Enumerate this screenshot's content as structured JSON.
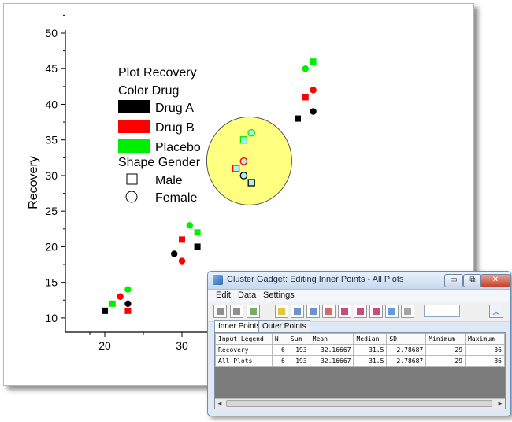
{
  "chart_data": {
    "type": "scatter",
    "ylabel": "Recovery",
    "xlabel": "",
    "xlim": [
      15,
      50
    ],
    "ylim": [
      8,
      50
    ],
    "x_ticks": [
      20,
      30
    ],
    "y_ticks": [
      10,
      15,
      20,
      25,
      30,
      35,
      40,
      45,
      50
    ],
    "colors": {
      "Drug A": "#000000",
      "Drug B": "#ff0000",
      "Placebo": "#00ee00"
    },
    "points": [
      {
        "x": 20,
        "y": 11,
        "color": "Drug A",
        "shape": "Male"
      },
      {
        "x": 23,
        "y": 12,
        "color": "Drug A",
        "shape": "Female"
      },
      {
        "x": 23,
        "y": 11,
        "color": "Drug B",
        "shape": "Male"
      },
      {
        "x": 22,
        "y": 13,
        "color": "Drug B",
        "shape": "Female"
      },
      {
        "x": 21,
        "y": 12,
        "color": "Placebo",
        "shape": "Male"
      },
      {
        "x": 23,
        "y": 14,
        "color": "Placebo",
        "shape": "Female"
      },
      {
        "x": 32,
        "y": 20,
        "color": "Drug A",
        "shape": "Male"
      },
      {
        "x": 29,
        "y": 19,
        "color": "Drug A",
        "shape": "Female"
      },
      {
        "x": 30,
        "y": 21,
        "color": "Drug B",
        "shape": "Male"
      },
      {
        "x": 30,
        "y": 18,
        "color": "Drug B",
        "shape": "Female"
      },
      {
        "x": 32,
        "y": 22,
        "color": "Placebo",
        "shape": "Male"
      },
      {
        "x": 31,
        "y": 23,
        "color": "Placebo",
        "shape": "Female"
      },
      {
        "x": 45,
        "y": 38,
        "color": "Drug A",
        "shape": "Male"
      },
      {
        "x": 47,
        "y": 39,
        "color": "Drug A",
        "shape": "Female"
      },
      {
        "x": 46,
        "y": 41,
        "color": "Drug B",
        "shape": "Male"
      },
      {
        "x": 47,
        "y": 42,
        "color": "Drug B",
        "shape": "Female"
      },
      {
        "x": 47,
        "y": 46,
        "color": "Placebo",
        "shape": "Male"
      },
      {
        "x": 46,
        "y": 45,
        "color": "Placebo",
        "shape": "Female"
      }
    ],
    "cluster_points": [
      {
        "x": 37,
        "y": 31,
        "color": "Drug B",
        "shape": "Male"
      },
      {
        "x": 38,
        "y": 32,
        "color": "Drug B",
        "shape": "Female"
      },
      {
        "x": 38,
        "y": 35,
        "color": "Placebo",
        "shape": "Male"
      },
      {
        "x": 39,
        "y": 36,
        "color": "Placebo",
        "shape": "Female"
      },
      {
        "x": 39,
        "y": 29,
        "color": "Drug A",
        "shape": "Male"
      },
      {
        "x": 38,
        "y": 30,
        "color": "Drug A",
        "shape": "Female"
      }
    ],
    "legend": {
      "title": "Plot Recovery",
      "color_heading": [
        "Color",
        "Drug"
      ],
      "color_items": [
        {
          "label": "Drug A",
          "color": "#000000"
        },
        {
          "label": "Drug B",
          "color": "#ff0000"
        },
        {
          "label": "Placebo",
          "color": "#00ee00"
        }
      ],
      "shape_heading": [
        "Shape",
        "Gender"
      ],
      "shape_items": [
        {
          "label": "Male",
          "symbol": "square"
        },
        {
          "label": "Female",
          "symbol": "circle"
        }
      ],
      "placement": "top-left"
    },
    "cluster_fill": "#ffff80"
  },
  "gadget": {
    "title": "Cluster Gadget: Editing Inner Points - All Plots",
    "menu": [
      "Edit",
      "Data",
      "Settings"
    ],
    "window_buttons": {
      "minimize": "▭",
      "maximize": "⧉",
      "close": "✕"
    },
    "collapse_symbol": "︽",
    "tabs": [
      "Inner Points",
      "Outer Points"
    ],
    "columns": [
      "Input Legend",
      "N",
      "Sum",
      "Mean",
      "Median",
      "SD",
      "Minimum",
      "Maximum"
    ],
    "rows": [
      [
        "Recovery",
        "6",
        "193",
        "32.16667",
        "31.5",
        "2.78687",
        "29",
        "36"
      ],
      [
        "All Plots",
        "6",
        "193",
        "32.16667",
        "31.5",
        "2.78687",
        "29",
        "36"
      ]
    ],
    "toolbar_icons": [
      "columns-icon",
      "rows-icon",
      "table-icon",
      "gadget-icon",
      "refresh-icon",
      "copy-icon",
      "edit-icon",
      "delete-data-icon",
      "mask-icon",
      "unmask-icon",
      "add-icon",
      "remove-icon"
    ],
    "scroll_left": "◄",
    "scroll_right": "►"
  }
}
